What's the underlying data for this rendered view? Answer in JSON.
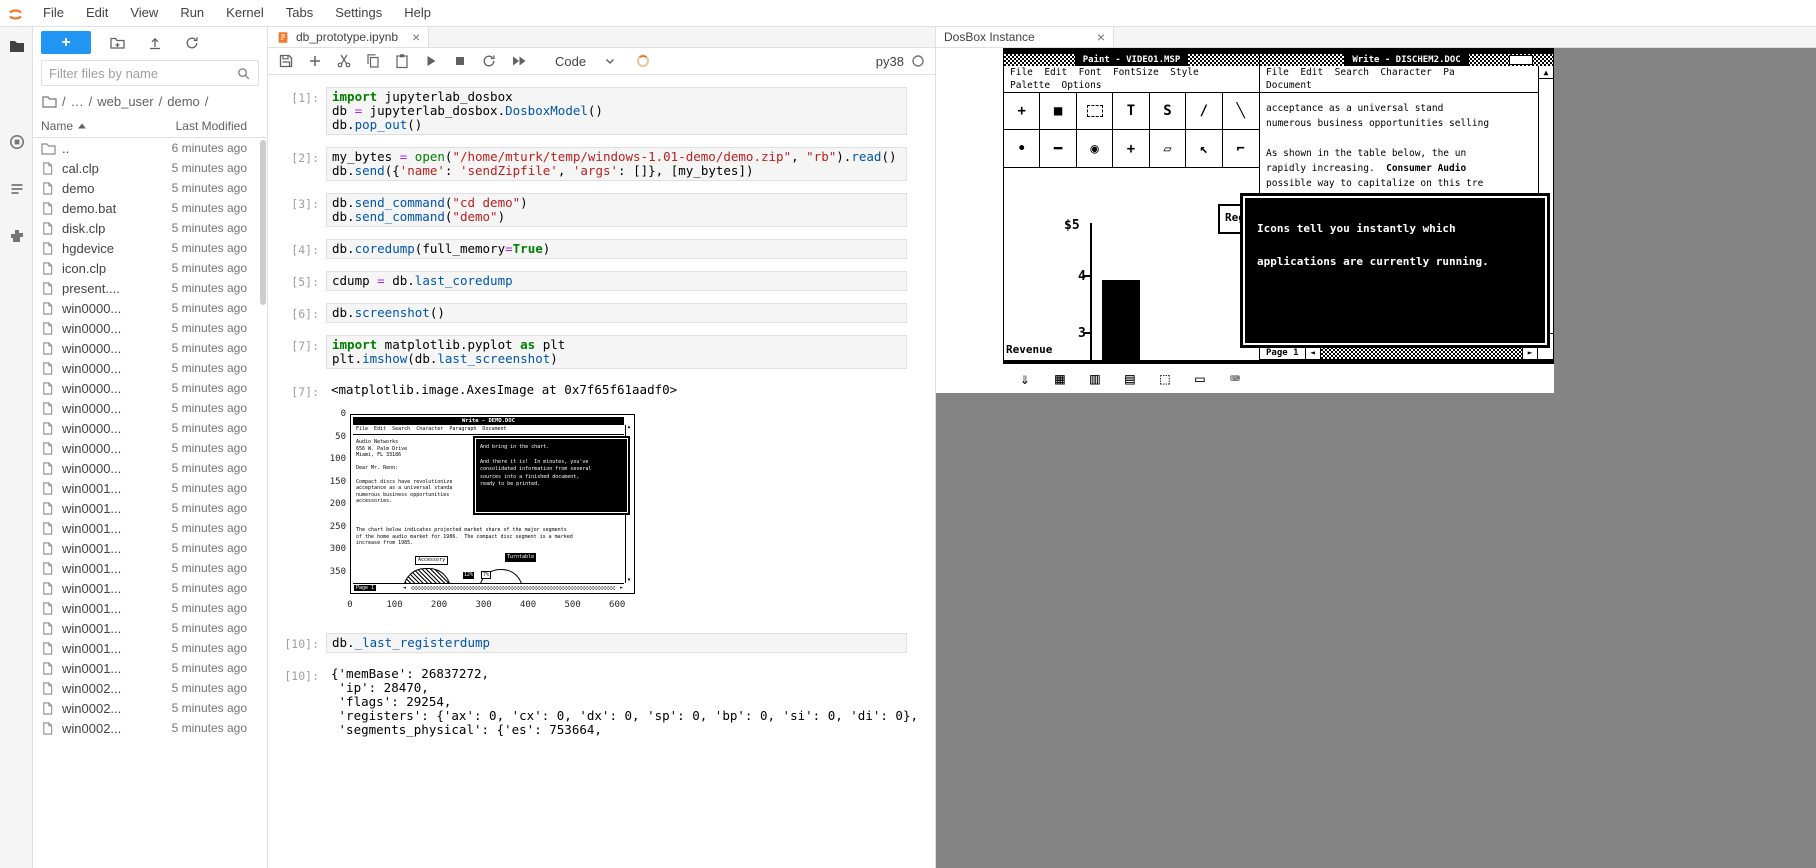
{
  "glyphs": {
    "close": "×",
    "up": "▲",
    "down": "▼",
    "left": "◄",
    "right": "►"
  },
  "menubar": {
    "items": [
      "File",
      "Edit",
      "View",
      "Run",
      "Kernel",
      "Tabs",
      "Settings",
      "Help"
    ]
  },
  "filebrowser": {
    "new_button": "+",
    "filter_placeholder": "Filter files by name",
    "breadcrumb": [
      "/",
      "…",
      "/",
      "web_user",
      "/",
      "demo",
      "/"
    ],
    "header": {
      "name": "Name",
      "modified": "Last Modified"
    },
    "files": [
      {
        "name": "..",
        "type": "folder",
        "modified": "6 minutes ago"
      },
      {
        "name": "cal.clp",
        "type": "file",
        "modified": "5 minutes ago"
      },
      {
        "name": "demo",
        "type": "file",
        "modified": "5 minutes ago"
      },
      {
        "name": "demo.bat",
        "type": "file",
        "modified": "5 minutes ago"
      },
      {
        "name": "disk.clp",
        "type": "file",
        "modified": "5 minutes ago"
      },
      {
        "name": "hgdevice",
        "type": "file",
        "modified": "5 minutes ago"
      },
      {
        "name": "icon.clp",
        "type": "file",
        "modified": "5 minutes ago"
      },
      {
        "name": "present....",
        "type": "file",
        "modified": "5 minutes ago"
      },
      {
        "name": "win0000...",
        "type": "file",
        "modified": "5 minutes ago"
      },
      {
        "name": "win0000...",
        "type": "file",
        "modified": "5 minutes ago"
      },
      {
        "name": "win0000...",
        "type": "file",
        "modified": "5 minutes ago"
      },
      {
        "name": "win0000...",
        "type": "file",
        "modified": "5 minutes ago"
      },
      {
        "name": "win0000...",
        "type": "file",
        "modified": "5 minutes ago"
      },
      {
        "name": "win0000...",
        "type": "file",
        "modified": "5 minutes ago"
      },
      {
        "name": "win0000...",
        "type": "file",
        "modified": "5 minutes ago"
      },
      {
        "name": "win0000...",
        "type": "file",
        "modified": "5 minutes ago"
      },
      {
        "name": "win0000...",
        "type": "file",
        "modified": "5 minutes ago"
      },
      {
        "name": "win0001...",
        "type": "file",
        "modified": "5 minutes ago"
      },
      {
        "name": "win0001...",
        "type": "file",
        "modified": "5 minutes ago"
      },
      {
        "name": "win0001...",
        "type": "file",
        "modified": "5 minutes ago"
      },
      {
        "name": "win0001...",
        "type": "file",
        "modified": "5 minutes ago"
      },
      {
        "name": "win0001...",
        "type": "file",
        "modified": "5 minutes ago"
      },
      {
        "name": "win0001...",
        "type": "file",
        "modified": "5 minutes ago"
      },
      {
        "name": "win0001...",
        "type": "file",
        "modified": "5 minutes ago"
      },
      {
        "name": "win0001...",
        "type": "file",
        "modified": "5 minutes ago"
      },
      {
        "name": "win0001...",
        "type": "file",
        "modified": "5 minutes ago"
      },
      {
        "name": "win0001...",
        "type": "file",
        "modified": "5 minutes ago"
      },
      {
        "name": "win0002...",
        "type": "file",
        "modified": "5 minutes ago"
      },
      {
        "name": "win0002...",
        "type": "file",
        "modified": "5 minutes ago"
      },
      {
        "name": "win0002...",
        "type": "file",
        "modified": "5 minutes ago"
      }
    ]
  },
  "notebook": {
    "tab_title": "db_prototype.ipynb",
    "toolbar": {
      "cell_type": "Code",
      "kernel_name": "py38"
    },
    "cells_a": [
      {
        "kind": "code",
        "prompt": "[1]:",
        "lines": [
          [
            [
              "kw",
              "import"
            ],
            [
              "v",
              " jupyterlab_dosbox"
            ]
          ],
          [
            [
              "v",
              "db "
            ],
            [
              "op",
              "="
            ],
            [
              "v",
              " jupyterlab_dosbox."
            ],
            [
              "prop",
              "DosboxModel"
            ],
            [
              "v",
              "()"
            ]
          ],
          [
            [
              "v",
              "db."
            ],
            [
              "prop",
              "pop_out"
            ],
            [
              "v",
              "()"
            ]
          ]
        ]
      },
      {
        "kind": "code",
        "prompt": "[2]:",
        "lines": [
          [
            [
              "v",
              "my_bytes "
            ],
            [
              "op",
              "="
            ],
            [
              "v",
              " "
            ],
            [
              "bi",
              "open"
            ],
            [
              "v",
              "("
            ],
            [
              "str",
              "\"/home/mturk/temp/windows-1.01-demo/demo.zip\""
            ],
            [
              "v",
              ", "
            ],
            [
              "str",
              "\"rb\""
            ],
            [
              "v",
              ")."
            ],
            [
              "prop",
              "read"
            ],
            [
              "v",
              "()"
            ]
          ],
          [
            [
              "v",
              "db."
            ],
            [
              "prop",
              "send"
            ],
            [
              "v",
              "({"
            ],
            [
              "str",
              "'name'"
            ],
            [
              "v",
              ": "
            ],
            [
              "str",
              "'sendZipfile'"
            ],
            [
              "v",
              ", "
            ],
            [
              "str",
              "'args'"
            ],
            [
              "v",
              ": []}, [my_bytes])"
            ]
          ]
        ]
      },
      {
        "kind": "code",
        "prompt": "[3]:",
        "lines": [
          [
            [
              "v",
              "db."
            ],
            [
              "prop",
              "send_command"
            ],
            [
              "v",
              "("
            ],
            [
              "str",
              "\"cd demo\""
            ],
            [
              "v",
              ")"
            ]
          ],
          [
            [
              "v",
              "db."
            ],
            [
              "prop",
              "send_command"
            ],
            [
              "v",
              "("
            ],
            [
              "str",
              "\"demo\""
            ],
            [
              "v",
              ")"
            ]
          ]
        ]
      },
      {
        "kind": "code",
        "prompt": "[4]:",
        "lines": [
          [
            [
              "v",
              "db."
            ],
            [
              "prop",
              "coredump"
            ],
            [
              "v",
              "(full_memory"
            ],
            [
              "op",
              "="
            ],
            [
              "kw",
              "True"
            ],
            [
              "v",
              ")"
            ]
          ]
        ]
      },
      {
        "kind": "code",
        "prompt": "[5]:",
        "lines": [
          [
            [
              "v",
              "cdump "
            ],
            [
              "op",
              "="
            ],
            [
              "v",
              " db."
            ],
            [
              "prop",
              "last_coredump"
            ]
          ]
        ]
      },
      {
        "kind": "code",
        "prompt": "[6]:",
        "lines": [
          [
            [
              "v",
              "db."
            ],
            [
              "prop",
              "screenshot"
            ],
            [
              "v",
              "()"
            ]
          ]
        ]
      },
      {
        "kind": "code",
        "prompt": "[7]:",
        "lines": [
          [
            [
              "kw",
              "import"
            ],
            [
              "v",
              " matplotlib.pyplot "
            ],
            [
              "kw",
              "as"
            ],
            [
              "v",
              " plt"
            ]
          ],
          [
            [
              "v",
              "plt."
            ],
            [
              "prop",
              "imshow"
            ],
            [
              "v",
              "(db."
            ],
            [
              "prop",
              "last_screenshot"
            ],
            [
              "v",
              ")"
            ]
          ]
        ]
      },
      {
        "kind": "output",
        "prompt": "[7]:",
        "lines": [
          "<matplotlib.image.AxesImage at 0x7f65f61aadf0>"
        ]
      }
    ],
    "cells_b": [
      {
        "kind": "code",
        "prompt": "[10]:",
        "lines": [
          [
            [
              "v",
              "db."
            ],
            [
              "prop",
              "_last_registerdump"
            ]
          ]
        ]
      },
      {
        "kind": "output",
        "prompt": "[10]:",
        "lines": [
          "{'memBase': 26837272,",
          " 'ip': 28470,",
          " 'flags': 29254,",
          " 'registers': {'ax': 0, 'cx': 0, 'dx': 0, 'sp': 0, 'bp': 0, 'si': 0, 'di': 0},",
          " 'segments_physical': {'es': 753664,"
        ]
      }
    ]
  },
  "figure": {
    "y_ticks": [
      0,
      50,
      100,
      150,
      200,
      250,
      300,
      350
    ],
    "x_ticks": [
      0,
      100,
      200,
      300,
      400,
      500,
      600
    ],
    "screen": {
      "title": "Write - DEMO.DOC",
      "menu": "File  Edit  Search  Character  Paragraph  Document",
      "left_lines": [
        "Audio Networks",
        "656 W. Palm Drive",
        "Miami, FL 33186",
        "",
        "Dear Mr. Renn:",
        "",
        "Compact discs have revolutionize",
        "acceptance as a universal standa",
        "numerous business opportunities",
        "accessories."
      ],
      "dialog_lines": [
        "And bring in the chart.",
        "",
        "And there it is!  In minutes, you've",
        "consolidated information from several",
        "sources into a finished document,",
        "ready to be printed."
      ],
      "para_lines": [
        "The chart below indicates projected market share of the major segments",
        "of the home audio market for 1986.  The compact disc segment is a marked",
        "increase from 1985."
      ],
      "chart_labels": {
        "accessory": "Accessory",
        "turntable": "Turntable",
        "pct1": "12%",
        "pct2": "7%"
      },
      "page": "Page 1"
    }
  },
  "dosbox": {
    "tab": "DosBox Instance",
    "paint": {
      "title": "Paint - VIDEO1.MSP",
      "menu1": "File  Edit  Font  FontSize  Style",
      "menu2": "Palette  Options",
      "tools": [
        "+",
        "■",
        "⬚",
        "T",
        "S",
        "/",
        "╲",
        "•",
        "━",
        "◉",
        "+",
        "▱",
        "↖",
        "⌐"
      ],
      "chart": {
        "labels": [
          "$5",
          "4",
          "3"
        ],
        "axis_label": "Revenue",
        "region_label": "Reg"
      }
    },
    "write": {
      "title": "Write - DISCHEM2.DOC",
      "menu1": "File  Edit  Search  Character  Pa",
      "menu2": "Document",
      "lines": [
        [
          [
            "n",
            "acceptance as a universal stand"
          ]
        ],
        [
          [
            "n",
            "numerous business opportunities selling"
          ]
        ],
        [
          [
            "n",
            ""
          ]
        ],
        [
          [
            "n",
            "As shown in the table below, the un"
          ]
        ],
        [
          [
            "n",
            "rapidly increasing.  "
          ],
          [
            "b",
            "Consumer Audio"
          ]
        ],
        [
          [
            "n",
            "possible way to capitalize on this tre"
          ]
        ]
      ],
      "page": "Page 1"
    },
    "dialog": [
      "Icons tell you instantly which",
      "applications are currently running."
    ],
    "desktop_icons": [
      "⇓",
      "▦",
      "▥",
      "▤",
      "⬚",
      "▭",
      "⌨"
    ]
  }
}
